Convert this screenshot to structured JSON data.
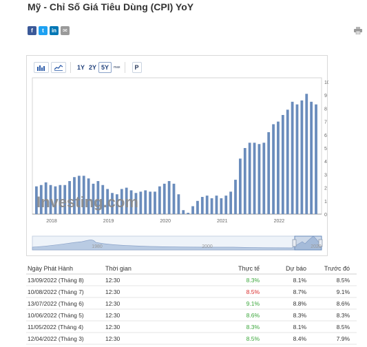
{
  "page": {
    "title": "Mỹ - Chỉ Số Giá Tiêu Dùng (CPI) YoY"
  },
  "share": {
    "facebook": "f",
    "twitter": "t",
    "linkedin": "in",
    "email": "✉",
    "print_icon": "printer-icon"
  },
  "toolbar": {
    "bar_icon": "bar-chart-icon",
    "line_icon": "line-chart-icon",
    "ranges": [
      "1Y",
      "2Y",
      "5Y",
      "max"
    ],
    "active_range": "5Y",
    "p_label": "P"
  },
  "watermark": {
    "text": "Investing.com"
  },
  "navigator": {
    "labels": [
      "1980",
      "2000",
      "2020"
    ]
  },
  "colors": {
    "bar": "#6a8cbc",
    "positive": "#3aa63a",
    "negative": "#d92b2b",
    "neutral": "#333333"
  },
  "chart_data": {
    "type": "bar",
    "x_ticks": [
      "2018",
      "2019",
      "2020",
      "2021",
      "2022"
    ],
    "y_ticks": [
      "0",
      "1",
      "2",
      "3",
      "4",
      "5",
      "6",
      "7",
      "8",
      "9",
      "10"
    ],
    "ylim": [
      0,
      10
    ],
    "grid": false,
    "values": [
      2.1,
      2.2,
      2.4,
      2.2,
      2.1,
      2.2,
      2.2,
      2.5,
      2.8,
      2.9,
      2.9,
      2.7,
      2.3,
      2.5,
      2.2,
      1.9,
      1.6,
      1.5,
      1.9,
      2.0,
      1.8,
      1.6,
      1.7,
      1.8,
      1.7,
      1.7,
      2.1,
      2.3,
      2.5,
      2.3,
      1.5,
      0.3,
      0.1,
      0.6,
      1.0,
      1.3,
      1.4,
      1.2,
      1.4,
      1.2,
      1.4,
      1.7,
      2.6,
      4.2,
      5.0,
      5.4,
      5.4,
      5.3,
      5.4,
      6.2,
      6.8,
      7.0,
      7.5,
      7.9,
      8.5,
      8.3,
      8.6,
      9.1,
      8.5,
      8.3
    ]
  },
  "table": {
    "headers": [
      "Ngày Phát Hành",
      "Thời gian",
      "Thực tế",
      "Dự báo",
      "Trước đó"
    ],
    "rows": [
      {
        "date": "13/09/2022 (Tháng 8)",
        "time": "12:30",
        "actual": "8.3%",
        "actual_status": "positive",
        "forecast": "8.1%",
        "previous": "8.5%"
      },
      {
        "date": "10/08/2022 (Tháng 7)",
        "time": "12:30",
        "actual": "8.5%",
        "actual_status": "negative",
        "forecast": "8.7%",
        "previous": "9.1%"
      },
      {
        "date": "13/07/2022 (Tháng 6)",
        "time": "12:30",
        "actual": "9.1%",
        "actual_status": "positive",
        "forecast": "8.8%",
        "previous": "8.6%"
      },
      {
        "date": "10/06/2022 (Tháng 5)",
        "time": "12:30",
        "actual": "8.6%",
        "actual_status": "positive",
        "forecast": "8.3%",
        "previous": "8.3%"
      },
      {
        "date": "11/05/2022 (Tháng 4)",
        "time": "12:30",
        "actual": "8.3%",
        "actual_status": "positive",
        "forecast": "8.1%",
        "previous": "8.5%"
      },
      {
        "date": "12/04/2022 (Tháng 3)",
        "time": "12:30",
        "actual": "8.5%",
        "actual_status": "positive",
        "forecast": "8.4%",
        "previous": "7.9%"
      }
    ]
  }
}
